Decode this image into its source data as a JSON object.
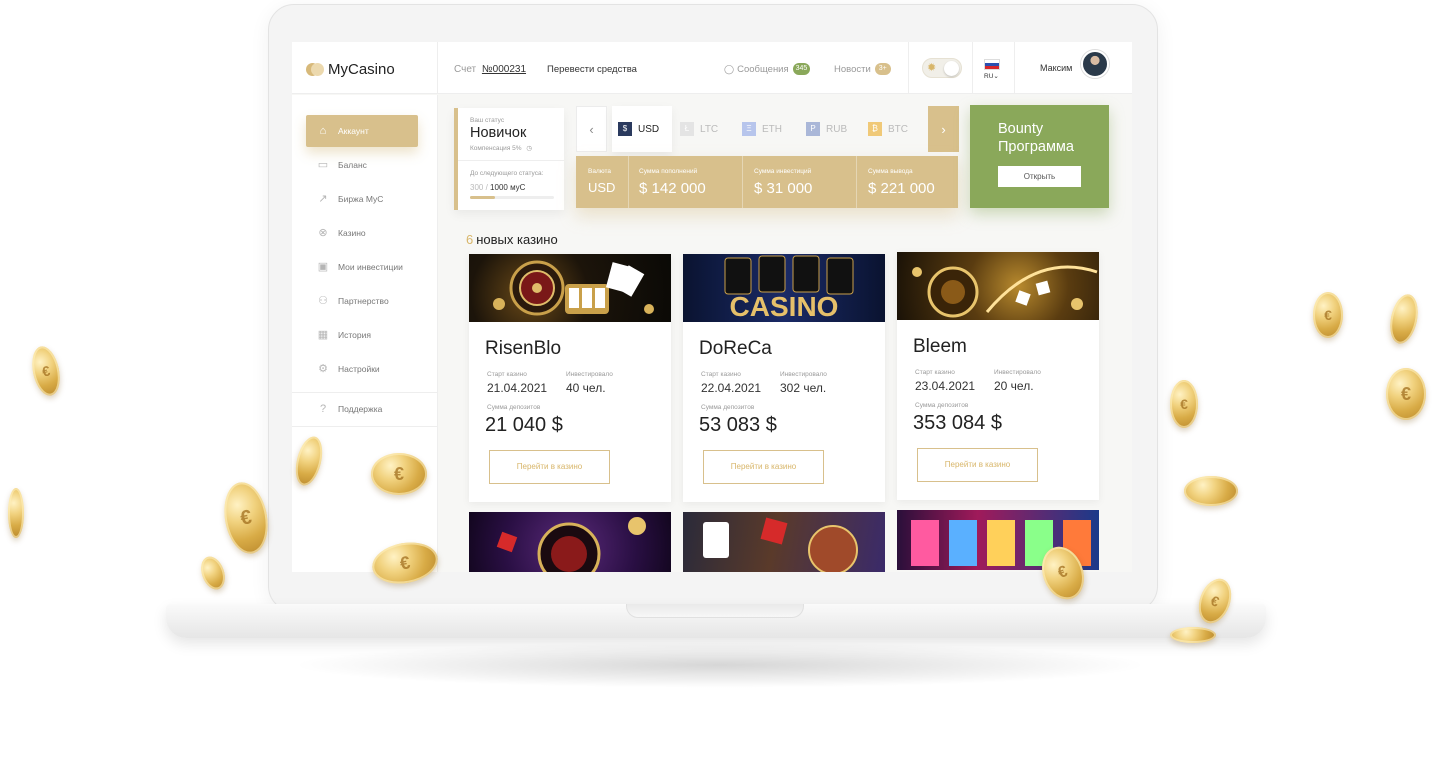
{
  "brand": {
    "name": "MyCasino"
  },
  "topbar": {
    "account_label": "Счет",
    "account_number": "№000231",
    "transfer": "Перевести средства",
    "messages_label": "Сообщения",
    "messages_count": "345",
    "news_label": "Новости",
    "news_count": "3+",
    "lang": "RU",
    "user_name": "Максим"
  },
  "sidebar": {
    "items": [
      {
        "label": "Аккаунт",
        "icon": "home-icon",
        "active": true
      },
      {
        "label": "Баланс",
        "icon": "card-icon"
      },
      {
        "label": "Биржа МуС",
        "icon": "trend-icon"
      },
      {
        "label": "Казино",
        "icon": "chip-icon"
      },
      {
        "label": "Мои инвестиции",
        "icon": "briefcase-icon"
      },
      {
        "label": "Партнерство",
        "icon": "users-icon"
      },
      {
        "label": "История",
        "icon": "calendar-icon"
      },
      {
        "label": "Настройки",
        "icon": "gear-icon"
      }
    ],
    "support": "Поддержка"
  },
  "status": {
    "label": "Ваш статус",
    "value": "Новичок",
    "compensation": "Компенсация 5%",
    "next_label": "До следующего статуса:",
    "current": "300",
    "target": "1000 муС",
    "progress": 0.3
  },
  "currencies": [
    {
      "code": "USD",
      "glyph": "$",
      "color": "#2a3a5e",
      "active": true
    },
    {
      "code": "LTC",
      "glyph": "Ł",
      "color": "#e4e4e4"
    },
    {
      "code": "ETH",
      "glyph": "Ξ",
      "color": "#b7c5ec"
    },
    {
      "code": "RUB",
      "glyph": "Р",
      "color": "#aab7d8"
    },
    {
      "code": "BTC",
      "glyph": "₿",
      "color": "#f0c978"
    }
  ],
  "amounts": {
    "currency_label": "Валюта",
    "currency_value": "USD",
    "deposits_label": "Сумма пополнений",
    "deposits_value": "$ 142 000",
    "investments_label": "Сумма инвестиций",
    "investments_value": "$ 31 000",
    "withdrawals_label": "Сумма вывода",
    "withdrawals_value": "$ 221 000"
  },
  "bounty": {
    "title_line1": "Bounty",
    "title_line2": "Программа",
    "button": "Открыть"
  },
  "new_casinos": {
    "count": "6",
    "label": "новых казино",
    "cards": [
      {
        "name": "RisenBlo",
        "start_label": "Старт казино",
        "start": "21.04.2021",
        "invested_label": "Инвестировало",
        "invested": "40 чел.",
        "deposits_label": "Сумма депозитов",
        "deposits": "21 040 $",
        "button": "Перейти в казино"
      },
      {
        "name": "DoReCa",
        "start_label": "Старт казино",
        "start": "22.04.2021",
        "invested_label": "Инвестировало",
        "invested": "302 чел.",
        "deposits_label": "Сумма депозитов",
        "deposits": "53 083 $",
        "button": "Перейти в казино"
      },
      {
        "name": "Bleem",
        "start_label": "Старт казино",
        "start": "23.04.2021",
        "invested_label": "Инвестировало",
        "invested": "20 чел.",
        "deposits_label": "Сумма депозитов",
        "deposits": "353 084 $",
        "button": "Перейти в казино"
      }
    ],
    "banner_text": "CASINO"
  },
  "colors": {
    "gold": "#d8c08c",
    "green": "#8aa85a",
    "badge_green": "#8aa85a"
  }
}
